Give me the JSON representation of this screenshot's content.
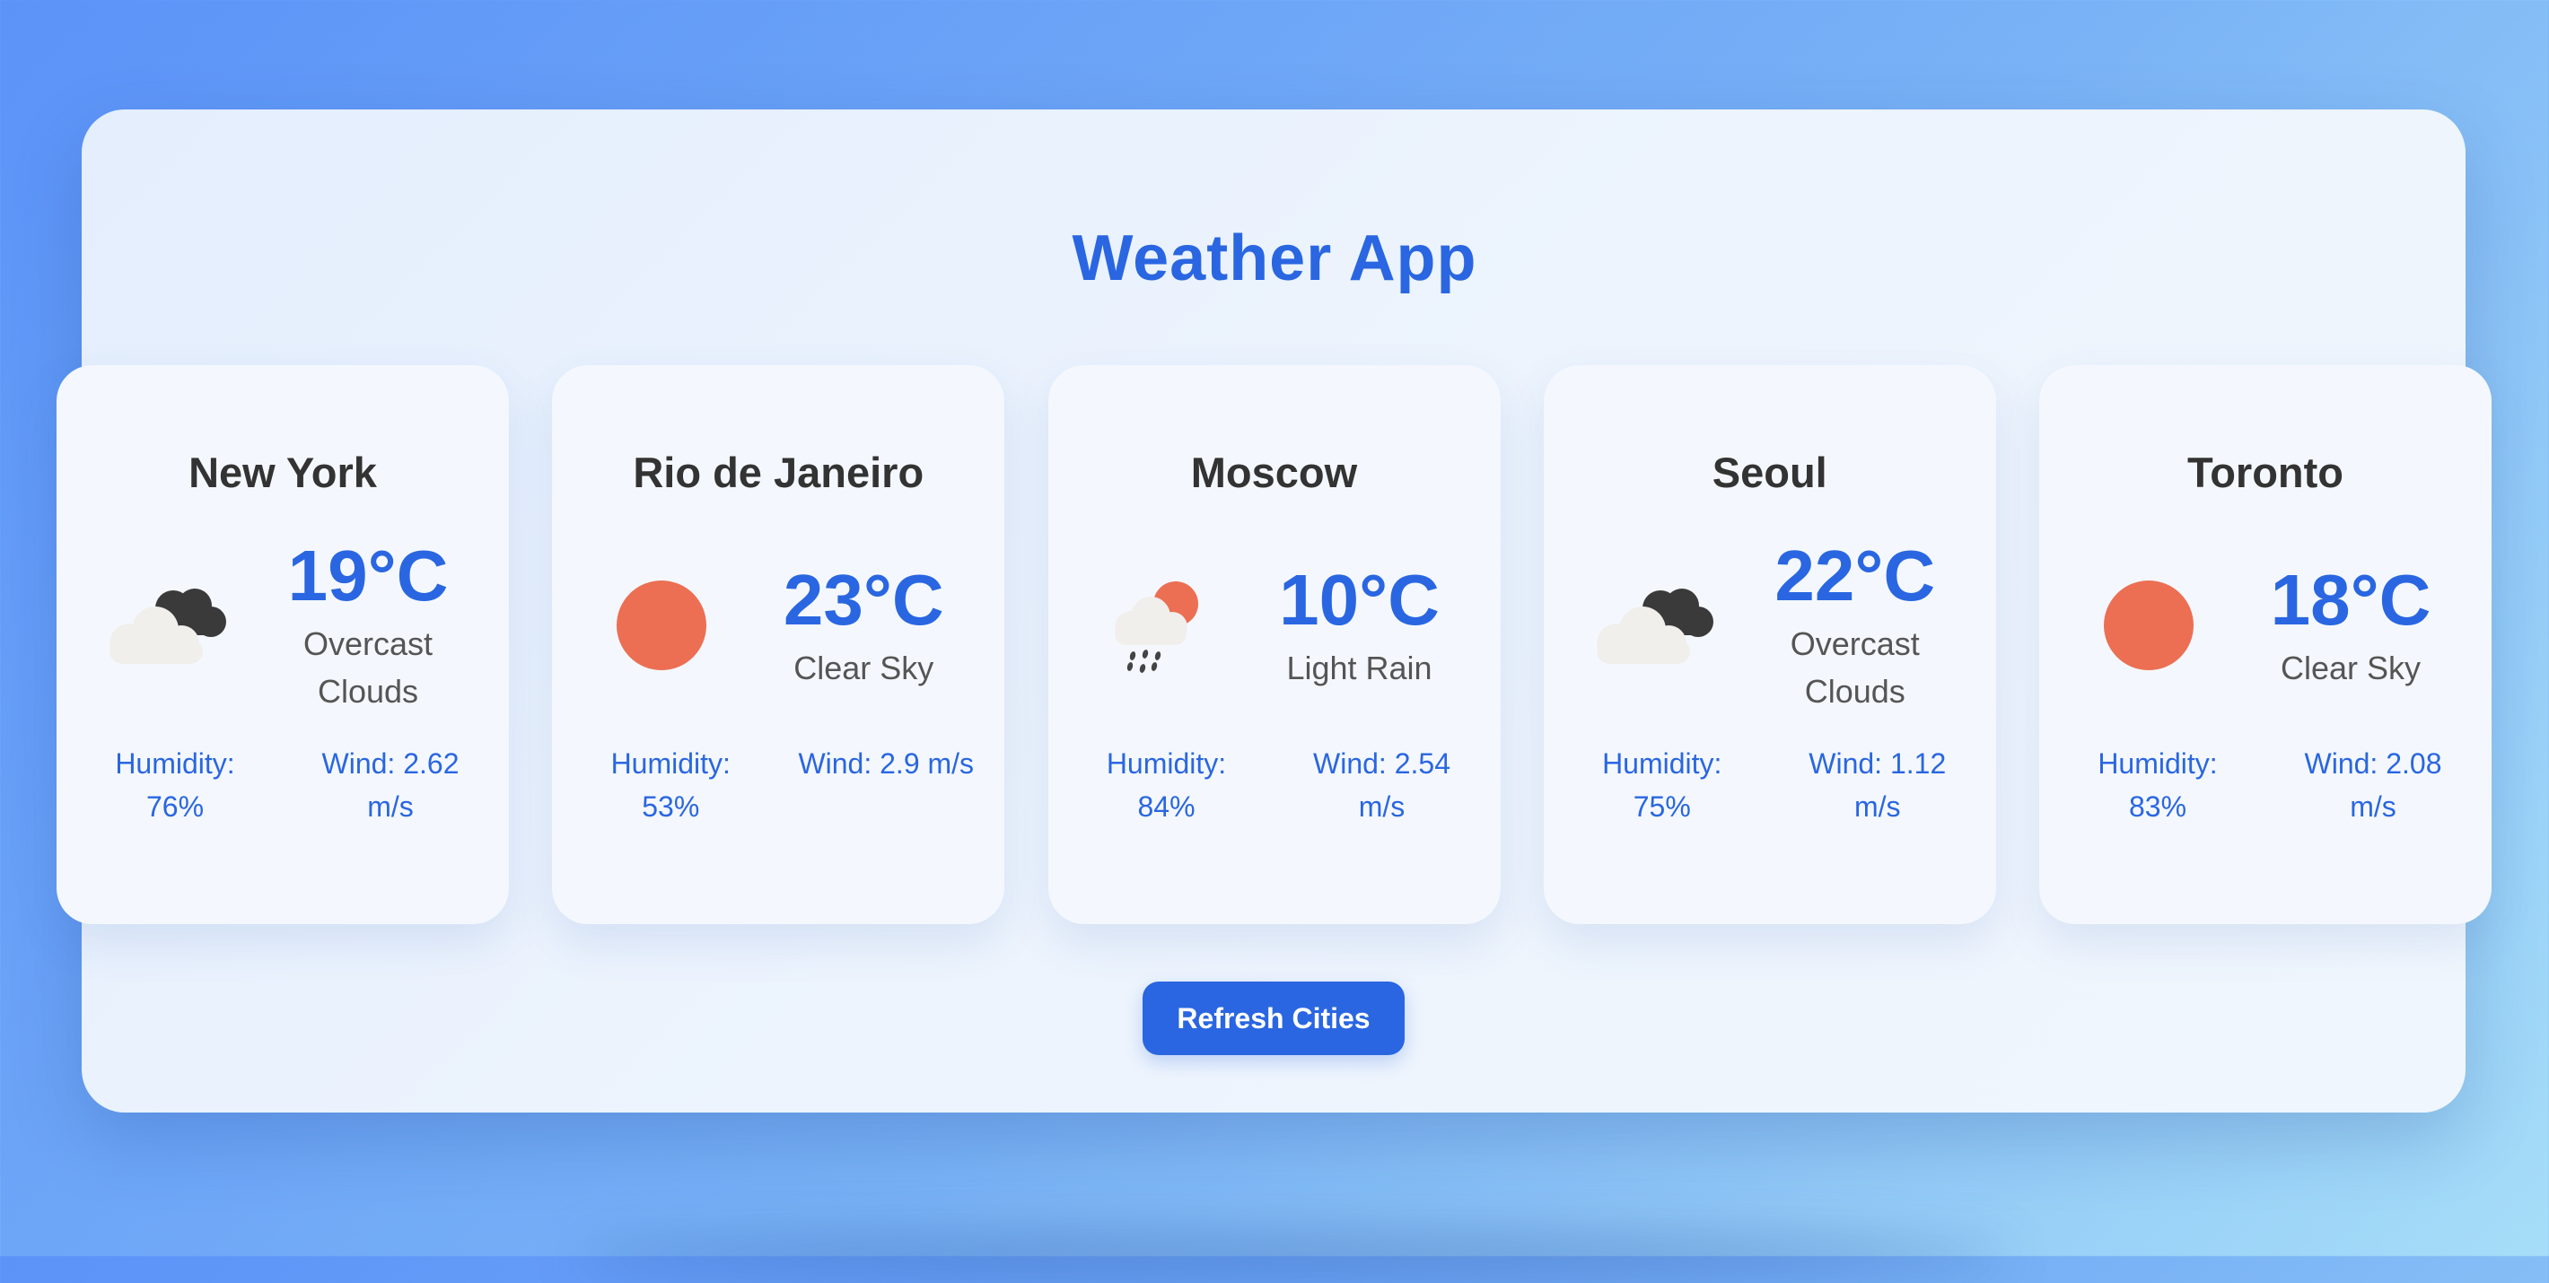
{
  "app": {
    "title": "Weather App",
    "refresh_label": "Refresh Cities"
  },
  "colors": {
    "accent": "#2a66e1",
    "sun": "#ec6f53",
    "cloud_dark": "#3a3a3a",
    "cloud_light": "#f1efec"
  },
  "cities": [
    {
      "name": "New York",
      "temp": "19°C",
      "condition": "Overcast Clouds",
      "icon": "overcast-clouds-icon",
      "humidity": "Humidity: 76%",
      "wind": "Wind: 2.62 m/s"
    },
    {
      "name": "Rio de Janeiro",
      "temp": "23°C",
      "condition": "Clear Sky",
      "icon": "sun-icon",
      "humidity": "Humidity: 53%",
      "wind": "Wind: 2.9 m/s"
    },
    {
      "name": "Moscow",
      "temp": "10°C",
      "condition": "Light Rain",
      "icon": "light-rain-icon",
      "humidity": "Humidity: 84%",
      "wind": "Wind: 2.54 m/s"
    },
    {
      "name": "Seoul",
      "temp": "22°C",
      "condition": "Overcast Clouds",
      "icon": "overcast-clouds-icon",
      "humidity": "Humidity: 75%",
      "wind": "Wind: 1.12 m/s"
    },
    {
      "name": "Toronto",
      "temp": "18°C",
      "condition": "Clear Sky",
      "icon": "sun-icon",
      "humidity": "Humidity: 83%",
      "wind": "Wind: 2.08 m/s"
    }
  ]
}
